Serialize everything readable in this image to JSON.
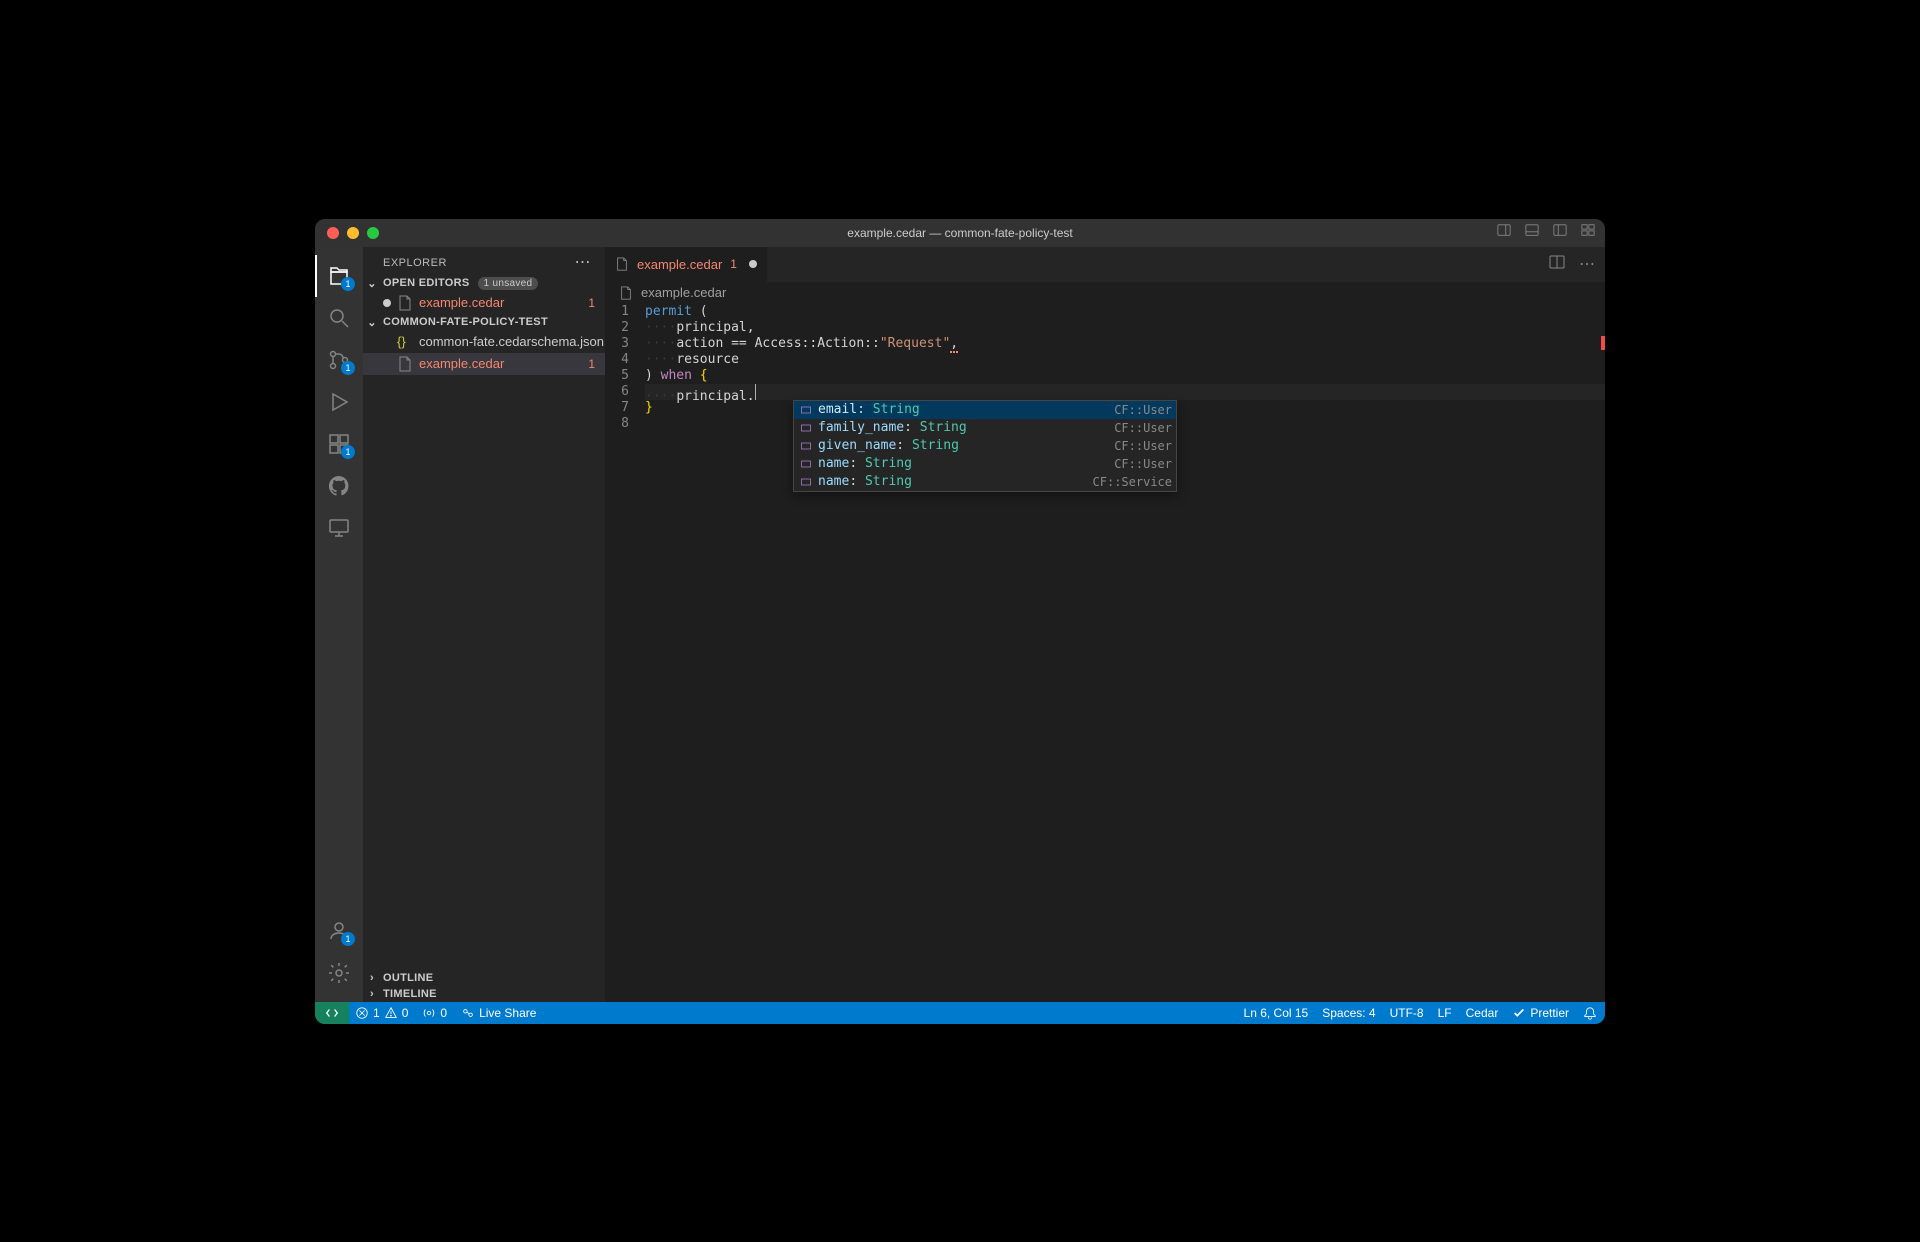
{
  "window": {
    "title": "example.cedar — common-fate-policy-test"
  },
  "sidebar": {
    "header": "EXPLORER",
    "openEditorsLabel": "OPEN EDITORS",
    "unsavedBadge": "1 unsaved",
    "folderLabel": "COMMON-FATE-POLICY-TEST",
    "outlineLabel": "OUTLINE",
    "timelineLabel": "TIMELINE",
    "openEditors": {
      "file": "example.cedar",
      "problems": "1"
    },
    "files": {
      "schema": "common-fate.cedarschema.json",
      "cedar": "example.cedar",
      "cedarProblems": "1"
    }
  },
  "activity": {
    "explorerBadge": "1",
    "scmBadge": "1",
    "accountBadge": "1"
  },
  "tab": {
    "name": "example.cedar",
    "problems": "1"
  },
  "breadcrumb": {
    "file": "example.cedar"
  },
  "code": {
    "l1": {
      "kw": "permit",
      "rest": " ("
    },
    "l2": {
      "indent": "····",
      "text": "principal,"
    },
    "l3": {
      "indent": "····",
      "a": "action ",
      "eq": "==",
      "b": " Access::Action::",
      "str": "\"Request\"",
      "tail": ","
    },
    "l4": {
      "indent": "····",
      "text": "resource"
    },
    "l5": {
      "a": ") ",
      "when": "when",
      "b": " {"
    },
    "l6": {
      "indent": "····",
      "text": "principal."
    },
    "l7": {
      "text": "}"
    }
  },
  "gutter": [
    "1",
    "2",
    "3",
    "4",
    "5",
    "6",
    "7",
    "8"
  ],
  "autocomplete": {
    "items": [
      {
        "prop": "email",
        "type": "String",
        "detail": "CF::User"
      },
      {
        "prop": "family_name",
        "type": "String",
        "detail": "CF::User"
      },
      {
        "prop": "given_name",
        "type": "String",
        "detail": "CF::User"
      },
      {
        "prop": "name",
        "type": "String",
        "detail": "CF::User"
      },
      {
        "prop": "name",
        "type": "String",
        "detail": "CF::Service"
      }
    ]
  },
  "status": {
    "errors": "1",
    "warnings": "0",
    "ports": "0",
    "liveShare": "Live Share",
    "lineCol": "Ln 6, Col 15",
    "spaces": "Spaces: 4",
    "encoding": "UTF-8",
    "eol": "LF",
    "language": "Cedar",
    "prettier": "Prettier"
  }
}
